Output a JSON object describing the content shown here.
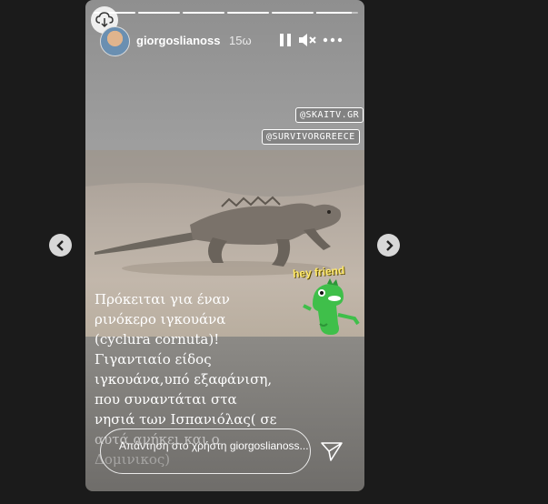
{
  "story": {
    "username": "giorgoslianoss",
    "time": "15ω",
    "progress": {
      "segments": 6,
      "completed": 6,
      "current_fraction": 0.85
    },
    "tags": [
      "@SKAITV.GR",
      "@SURVIVORGREECE"
    ],
    "sticker_text": "hey friend",
    "caption_lines": [
      "Πρόκειται για έναν",
      "ρινόκερο ιγκουάνα",
      "(cyclura cornuta)!",
      "Γιγαντιαίο είδος",
      "ιγκουάνα,υπό εξαφάνιση,",
      "που συναντάται στα",
      "νησιά των Ισπανιόλας( σε",
      "αυτά ανήκει και ο",
      "Δομινικος)"
    ],
    "reply_placeholder": "Απάντηση στο χρήστη giorgoslianoss..."
  },
  "icons": {
    "cloud": "cloud-download-icon",
    "pause": "pause-icon",
    "mute": "mute-icon",
    "more": "more-icon",
    "prev": "chevron-left-icon",
    "next": "chevron-right-icon",
    "send": "send-icon"
  },
  "colors": {
    "background": "#1b1b1b",
    "sticker": "#ffe96b",
    "dino": "#3fbf4a"
  }
}
